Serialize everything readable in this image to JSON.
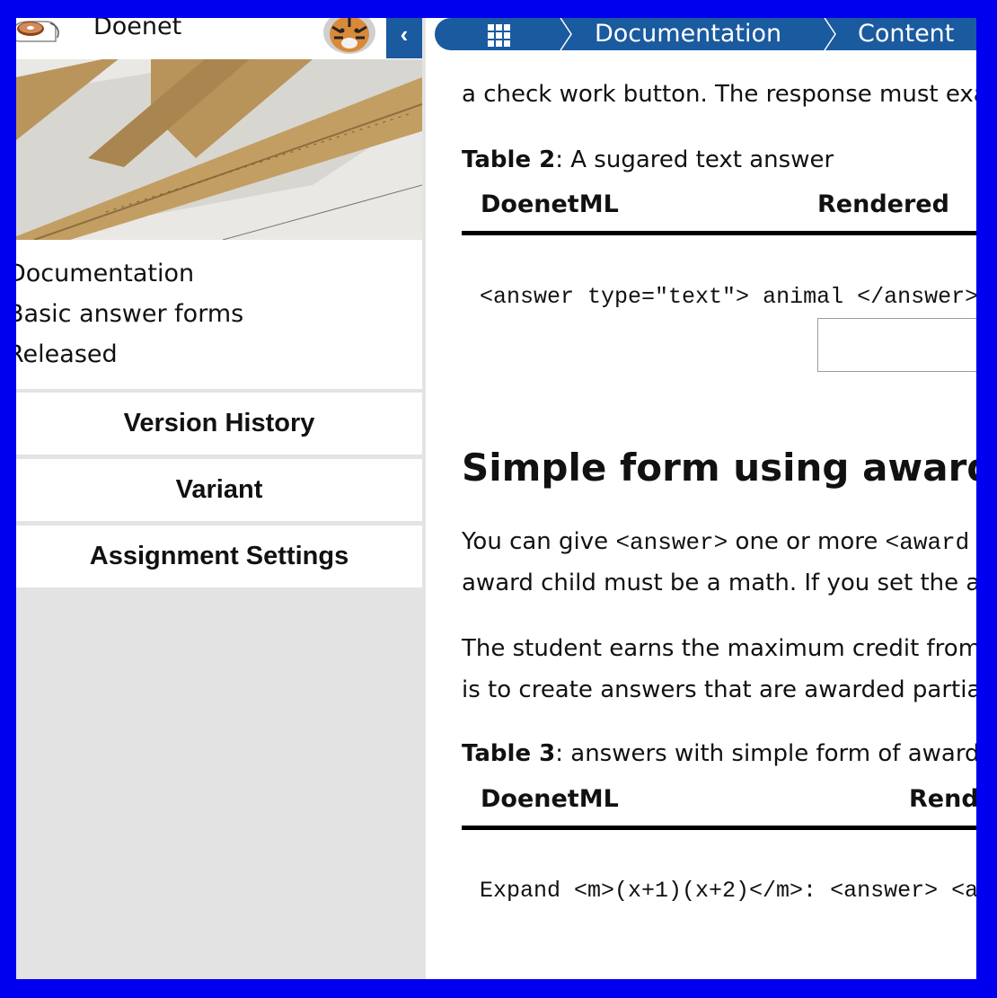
{
  "app": {
    "name": "Doenet"
  },
  "sidebar": {
    "info": {
      "collection": "Documentation",
      "activity": "Basic answer forms",
      "status": "Released"
    },
    "buttons": {
      "version_history": "Version History",
      "variant": "Variant",
      "assignment_settings": "Assignment Settings"
    }
  },
  "breadcrumb": {
    "items": [
      "Documentation",
      "Content"
    ]
  },
  "content": {
    "intro_tail": "a check work button. The response must exa",
    "table2": {
      "caption_label": "Table 2",
      "caption_text": ": A sugared text answer",
      "headers": [
        "DoenetML",
        "Rendered"
      ],
      "code": [
        "<answer type=\"text\">",
        "  animal",
        "</answer>"
      ]
    },
    "section_heading": "Simple form using award",
    "para1": {
      "line1_a": "You can give ",
      "line1_code1": "<answer>",
      "line1_b": " one or more ",
      "line1_code2": "<award",
      "line2": "award child must be a math. If you set the a"
    },
    "para2": {
      "line1": "The student earns the maximum credit from",
      "line2": "is to create answers that are awarded partia"
    },
    "table3": {
      "caption_label": "Table 3",
      "caption_text": ": answers with simple form of award",
      "headers": [
        "DoenetML",
        "Rende"
      ],
      "code": [
        "Expand <m>(x+1)(x+2)</m>:",
        "<answer>",
        "  <award symbolicEquality"
      ]
    }
  },
  "colors": {
    "frame": "#0000ee",
    "accent": "#1a5a9f",
    "panel_gray": "#e3e3e3"
  }
}
